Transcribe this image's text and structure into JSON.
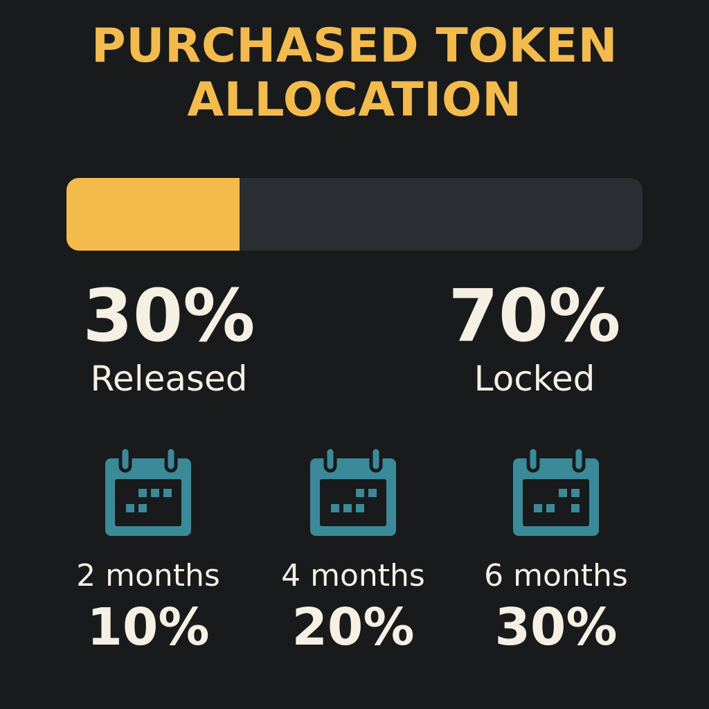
{
  "title": {
    "line1": "PURCHASED TOKEN",
    "line2": "ALLOCATION"
  },
  "colors": {
    "background": "#181a1c",
    "accent": "#f2bb4b",
    "track": "#2b2e32",
    "icon": "#3b8a99",
    "text": "#f6efe3"
  },
  "allocation_bar": {
    "released_fraction": 0.3,
    "locked_fraction": 0.7
  },
  "released": {
    "percent": "30%",
    "label": "Released"
  },
  "locked": {
    "percent": "70%",
    "label": "Locked"
  },
  "schedule": [
    {
      "icon": "calendar-icon",
      "period": "2 months",
      "share": "10%"
    },
    {
      "icon": "calendar-icon",
      "period": "4 months",
      "share": "20%"
    },
    {
      "icon": "calendar-icon",
      "period": "6 months",
      "share": "30%"
    }
  ]
}
